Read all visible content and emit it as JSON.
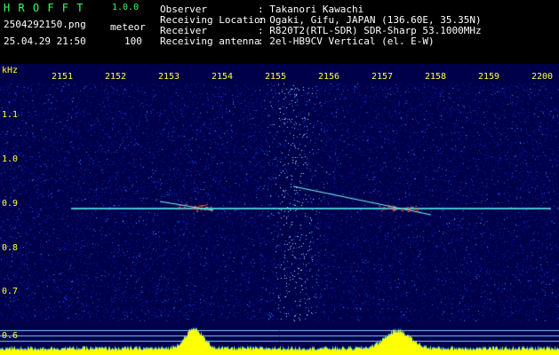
{
  "title": "H R O F F T",
  "version": "1.0.0",
  "filename": "2504292150.png",
  "datetime": "25.04.29 21:50",
  "mode": "meteor",
  "count": "100",
  "info": [
    {
      "label": "Observer",
      "value": ": Takanori Kawachi"
    },
    {
      "label": "Receiving Location",
      "value": ": Ogaki, Gifu, JAPAN (136.60E, 35.35N)"
    },
    {
      "label": "Receiver",
      "value": ": R820T2(RTL-SDR) SDR-Sharp 53.1000MHz"
    },
    {
      "label": "Receiving antenna",
      "value": ": 2el-HB9CV Vertical (el. E-W)"
    }
  ],
  "axis": {
    "unit": "kHz",
    "x_ticks": [
      "2151",
      "2152",
      "2153",
      "2154",
      "2155",
      "2156",
      "2157",
      "2158",
      "2159",
      "2200"
    ],
    "y_ticks": [
      "1.1",
      "1.0",
      "0.9",
      "0.8",
      "0.7",
      "0.6"
    ]
  },
  "colors": {
    "background": "#000000",
    "spectrum_base": "#00004a",
    "signal": "#66ffff",
    "power": "#ffff00",
    "label": "#ffff33"
  }
}
